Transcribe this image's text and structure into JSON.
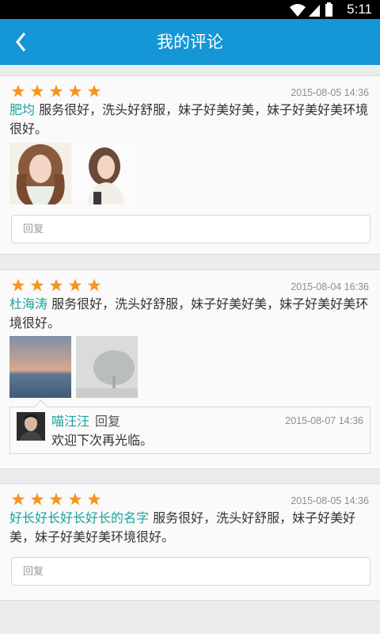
{
  "status_bar": {
    "time": "5:11"
  },
  "header": {
    "title": "我的评论"
  },
  "colors": {
    "accent": "#1596d6",
    "star": "#f7931e",
    "username": "#1aa3a0"
  },
  "reviews": [
    {
      "rating": 5,
      "date": "2015-08-05 14:36",
      "user": "肥均",
      "text": " 服务很好，洗头好舒服，妹子好美好美，妹子好美好美环境很好。",
      "photos": [
        "portrait-woman-curly-hair",
        "portrait-woman-white-top"
      ],
      "reply_placeholder": "回复"
    },
    {
      "rating": 5,
      "date": "2015-08-04 16:36",
      "user": "杜海涛",
      "text": " 服务很好，洗头好舒服，妹子好美好美，妹子好美好美环境很好。",
      "photos": [
        "sunset-sea",
        "foggy-tree"
      ],
      "reply": {
        "name": "喵汪汪",
        "tag": "回复",
        "date": "2015-08-07 14:36",
        "text": "欢迎下次再光临。"
      }
    },
    {
      "rating": 5,
      "date": "2015-08-05 14:36",
      "user": "好长好长好长好长的名字",
      "text": " 服务很好，洗头好舒服，妹子好美好美，妹子好美好美环境很好。",
      "photos": [],
      "reply_placeholder": "回复"
    }
  ]
}
